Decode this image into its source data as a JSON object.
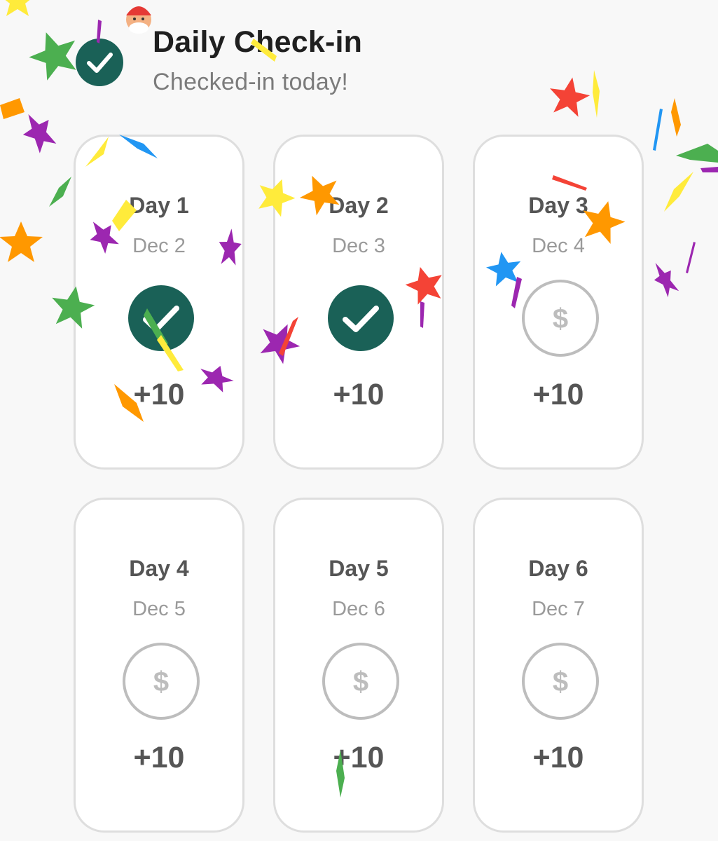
{
  "header": {
    "title": "Daily Check-in",
    "subtitle": "Checked-in today!",
    "status_icon": "check-circle-icon"
  },
  "colors": {
    "accent": "#1a6157",
    "pending_icon": "#bdbdbd",
    "card_border": "#dedede",
    "background": "#f8f8f8"
  },
  "days": [
    {
      "label": "Day 1",
      "date": "Dec 2",
      "reward": "+10",
      "checked": true
    },
    {
      "label": "Day 2",
      "date": "Dec 3",
      "reward": "+10",
      "checked": true
    },
    {
      "label": "Day 3",
      "date": "Dec 4",
      "reward": "+10",
      "checked": false
    },
    {
      "label": "Day 4",
      "date": "Dec 5",
      "reward": "+10",
      "checked": false
    },
    {
      "label": "Day 5",
      "date": "Dec 6",
      "reward": "+10",
      "checked": false
    },
    {
      "label": "Day 6",
      "date": "Dec 7",
      "reward": "+10",
      "checked": false
    }
  ],
  "pending_symbol": "$",
  "confetti_colors": [
    "#4caf50",
    "#9c27b0",
    "#ff9800",
    "#ffeb3b",
    "#f44336",
    "#2196f3"
  ]
}
